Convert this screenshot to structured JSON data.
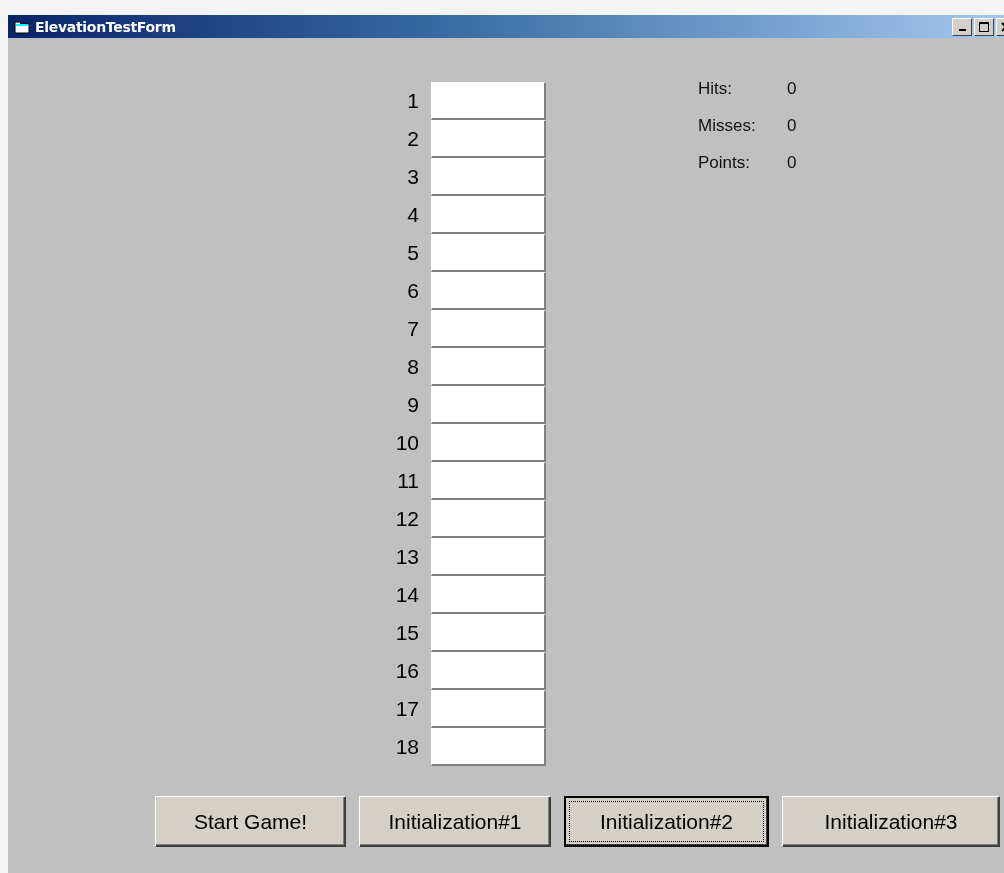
{
  "window": {
    "title": "ElevationTestForm"
  },
  "fields": [
    {
      "label": "1"
    },
    {
      "label": "2"
    },
    {
      "label": "3"
    },
    {
      "label": "4"
    },
    {
      "label": "5"
    },
    {
      "label": "6"
    },
    {
      "label": "7"
    },
    {
      "label": "8"
    },
    {
      "label": "9"
    },
    {
      "label": "10"
    },
    {
      "label": "11"
    },
    {
      "label": "12"
    },
    {
      "label": "13"
    },
    {
      "label": "14"
    },
    {
      "label": "15"
    },
    {
      "label": "16"
    },
    {
      "label": "17"
    },
    {
      "label": "18"
    }
  ],
  "stats": [
    {
      "label": "Hits:",
      "value": "0"
    },
    {
      "label": "Misses:",
      "value": "0"
    },
    {
      "label": "Points:",
      "value": "0"
    }
  ],
  "buttons": [
    {
      "label": "Start Game!",
      "focused": false
    },
    {
      "label": "Initialization#1",
      "focused": false
    },
    {
      "label": "Initialization#2",
      "focused": true
    },
    {
      "label": "Initialization#3",
      "focused": false
    }
  ]
}
